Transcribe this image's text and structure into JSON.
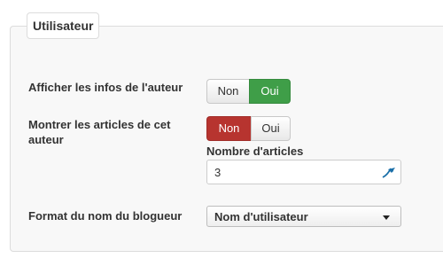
{
  "section": {
    "legend": "Utilisateur"
  },
  "fields": {
    "author_info": {
      "label": "Afficher les infos de l'auteur",
      "no_label": "Non",
      "yes_label": "Oui",
      "selected": "Oui"
    },
    "author_articles": {
      "label": "Montrer les articles de cet auteur",
      "no_label": "Non",
      "yes_label": "Oui",
      "selected": "Non",
      "count_label": "Nombre d'articles",
      "count_value": "3"
    },
    "blogger_name_format": {
      "label": "Format du nom du blogueur",
      "selected_option": "Nom d'utilisateur"
    }
  },
  "colors": {
    "active_yes": "#3f9e48",
    "active_no": "#b7342f",
    "input_icon": "#1a6fa8"
  }
}
